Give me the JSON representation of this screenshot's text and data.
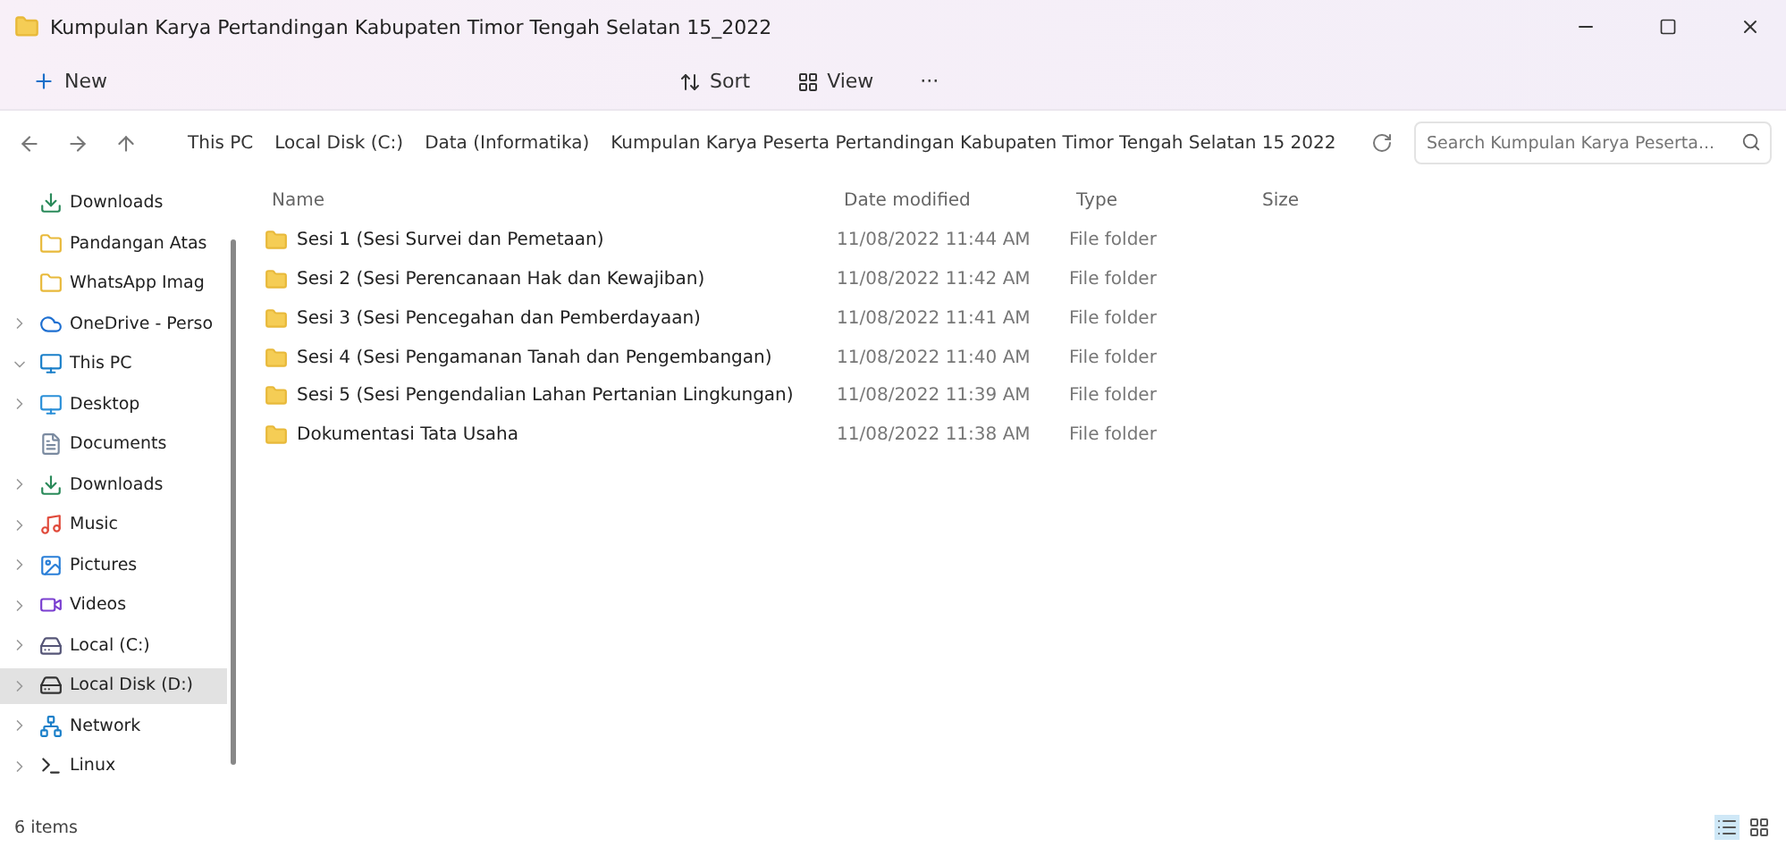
{
  "window": {
    "title": "Kumpulan Karya Pertandingan Kabupaten Timor Tengah Selatan 15_2022"
  },
  "toolbar": {
    "new": "New",
    "sort": "Sort",
    "view": "View",
    "more": "···"
  },
  "address": {
    "crumbs": [
      "This PC",
      "Local Disk (C:)",
      "Data (Informatika)",
      "Kumpulan Karya Peserta Pertandingan Kabupaten Timor Tengah Selatan 15 2022"
    ],
    "search": {
      "placeholder": "Search Kumpulan Karya Peserta..."
    }
  },
  "sidebar": {
    "items": [
      {
        "label": "Downloads",
        "selected": false
      },
      {
        "label": "Pandangan Atas",
        "selected": false
      },
      {
        "label": "WhatsApp Imag",
        "selected": false
      },
      {
        "label": "OneDrive - Perso",
        "selected": false
      },
      {
        "label": "This PC",
        "selected": false
      },
      {
        "label": "Desktop",
        "selected": false
      },
      {
        "label": "Documents",
        "selected": false
      },
      {
        "label": "Downloads",
        "selected": false
      },
      {
        "label": "Music",
        "selected": false
      },
      {
        "label": "Pictures",
        "selected": false
      },
      {
        "label": "Videos",
        "selected": false
      },
      {
        "label": "Local (C:)",
        "selected": false
      },
      {
        "label": "Local Disk (D:)",
        "selected": true
      },
      {
        "label": "Network",
        "selected": false
      },
      {
        "label": "Linux",
        "selected": false
      }
    ]
  },
  "table": {
    "columns": [
      "Name",
      "Date modified",
      "Type",
      "Size"
    ],
    "rows": [
      {
        "name": "Sesi 1 (Sesi Survei dan Pemetaan)",
        "date": "11/08/2022 11:44 AM",
        "type": "File folder"
      },
      {
        "name": "Sesi 2 (Sesi Perencanaan Hak dan Kewajiban)",
        "date": "11/08/2022 11:42 AM",
        "type": "File folder"
      },
      {
        "name": "Sesi 3 (Sesi Pencegahan dan Pemberdayaan)",
        "date": "11/08/2022 11:41 AM",
        "type": "File folder"
      },
      {
        "name": "Sesi 4 (Sesi Pengamanan Tanah dan Pengembangan)",
        "date": "11/08/2022 11:40 AM",
        "type": "File folder"
      },
      {
        "name": "Sesi 5 (Sesi Pengendalian Lahan Pertanian Lingkungan)",
        "date": "11/08/2022 11:39 AM",
        "type": "File folder"
      },
      {
        "name": "Dokumentasi Tata Usaha",
        "date": "11/08/2022 11:38 AM",
        "type": "File folder"
      }
    ]
  },
  "status_bar": {
    "count": "6 items"
  }
}
